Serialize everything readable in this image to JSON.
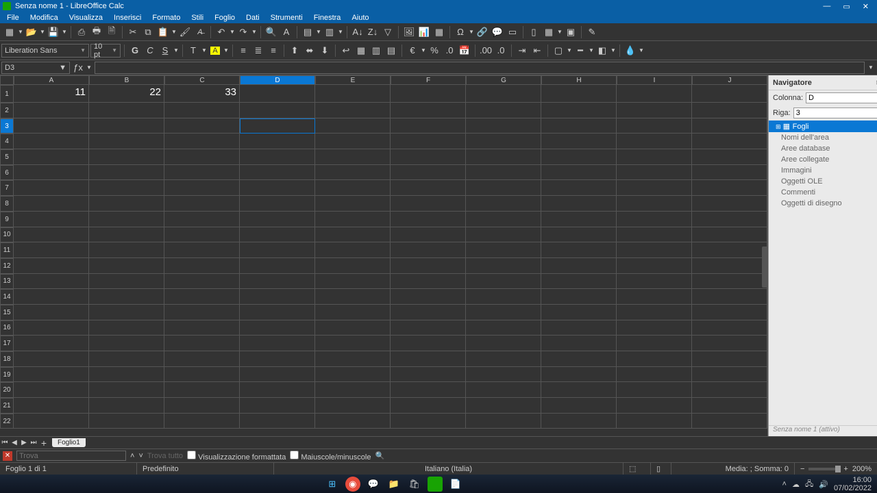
{
  "title": "Senza nome 1 - LibreOffice Calc",
  "window_controls": {
    "min": "—",
    "max": "▭",
    "close": "✕"
  },
  "menu": [
    "File",
    "Modifica",
    "Visualizza",
    "Inserisci",
    "Formato",
    "Stili",
    "Foglio",
    "Dati",
    "Strumenti",
    "Finestra",
    "Aiuto"
  ],
  "font": {
    "name": "Liberation Sans",
    "size": "10 pt"
  },
  "namebox": "D3",
  "formula": "",
  "columns": [
    "A",
    "B",
    "C",
    "D",
    "E",
    "F",
    "G",
    "H",
    "I",
    "J"
  ],
  "active_col": "D",
  "active_row": 3,
  "row_count": 22,
  "cells": {
    "A1": "11",
    "B1": "22",
    "C1": "33"
  },
  "navigator": {
    "title": "Navigatore",
    "col_label": "Colonna:",
    "col_value": "D",
    "row_label": "Riga:",
    "row_value": "3",
    "tree": [
      "Fogli",
      "Nomi dell'area",
      "Aree database",
      "Aree collegate",
      "Immagini",
      "Oggetti OLE",
      "Commenti",
      "Oggetti di disegno"
    ],
    "footer": "Senza nome 1 (attivo)"
  },
  "tabs": {
    "sheet1": "Foglio1"
  },
  "find": {
    "placeholder": "Trova",
    "all": "Trova tutto",
    "formatted": "Visualizzazione formattata",
    "case": "Maiuscole/minuscole"
  },
  "status": {
    "sheet": "Foglio 1 di 1",
    "style": "Predefinito",
    "lang": "Italiano (Italia)",
    "calc": "Media: ; Somma: 0",
    "zoom": "200%"
  },
  "tray": {
    "time": "16:00",
    "date": "07/02/2022"
  }
}
